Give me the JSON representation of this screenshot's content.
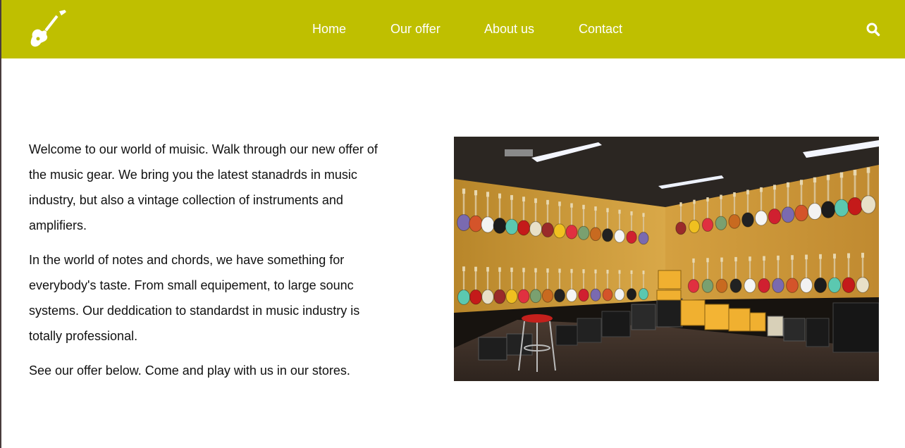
{
  "header": {
    "background": "#bfbf00",
    "logo_icon": "electric-guitar-icon",
    "nav": {
      "home": "Home",
      "offer": "Our offer",
      "about": "About us",
      "contact": "Contact"
    },
    "search_icon": "search-icon"
  },
  "main": {
    "paragraphs": [
      "Welcome to our world of muisic. Walk through our new offer of the music gear. We bring you the latest stanadrds in music industry, but also a vintage collection of instruments and amplifiers.",
      "In the world of notes and chords, we have something for everybody's taste. From small equipement, to large sounc systems. Our deddication to standardst in music industry is totally professional.",
      "See our offer below. Come and play with us in our stores."
    ],
    "photo_subject": "guitar-store-photo"
  }
}
